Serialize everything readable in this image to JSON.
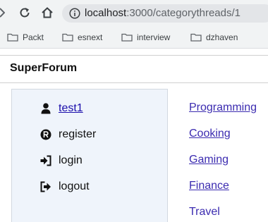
{
  "browser": {
    "url_host": "localhost",
    "url_path": ":3000/categorythreads/1",
    "bookmarks": [
      "Packt",
      "esnext",
      "interview",
      "dzhaven"
    ]
  },
  "app": {
    "title": "SuperForum"
  },
  "left_menu": {
    "items": [
      {
        "label": "test1",
        "icon": "user-icon"
      },
      {
        "label": "register",
        "icon": "registered-icon"
      },
      {
        "label": "login",
        "icon": "sign-in-icon"
      },
      {
        "label": "logout",
        "icon": "sign-out-icon"
      }
    ]
  },
  "categories": [
    "Programming",
    "Cooking",
    "Gaming",
    "Finance",
    "Travel"
  ],
  "colors": {
    "link": "#3b2bb0",
    "menu_background": "#eff4fb"
  }
}
